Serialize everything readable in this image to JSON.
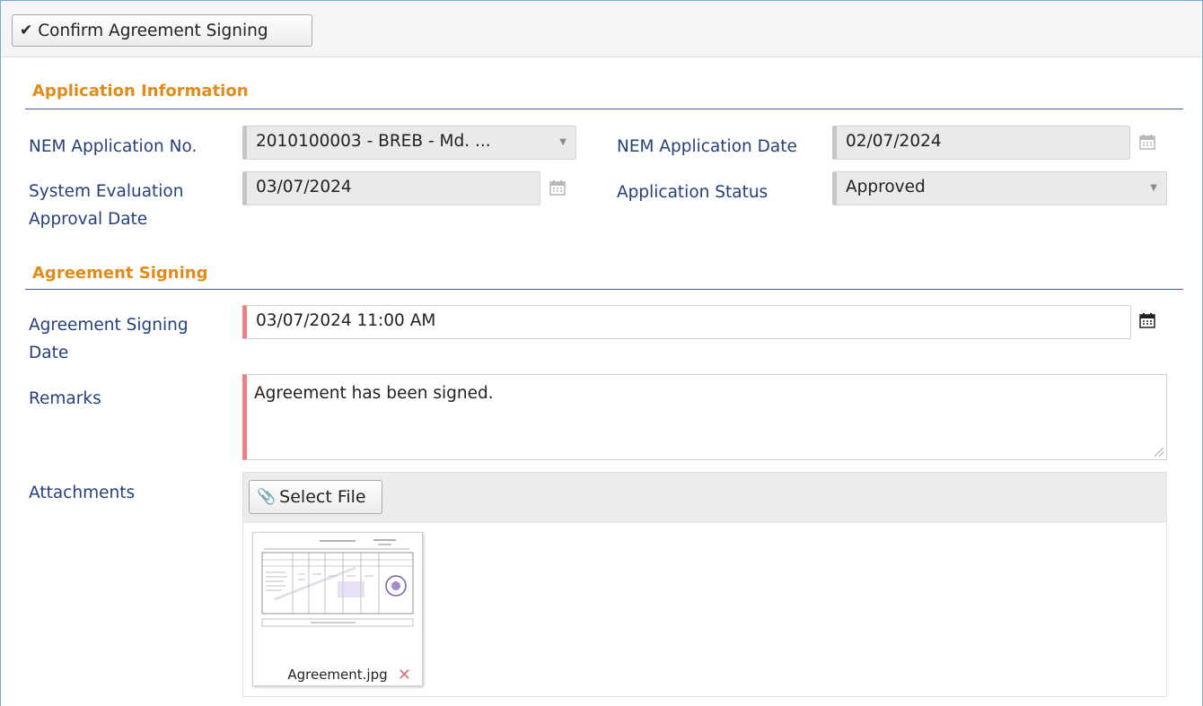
{
  "toolbar": {
    "confirm_label": "Confirm Agreement Signing",
    "confirm_icon": "check-icon"
  },
  "application_info": {
    "title": "Application Information",
    "nem_app_no_label": "NEM Application No.",
    "nem_app_no_value": "2010100003 - BREB - Md. ...",
    "nem_app_date_label": "NEM Application Date",
    "nem_app_date_value": "02/07/2024",
    "sys_eval_label_1": "System Evaluation",
    "sys_eval_label_2": "Approval Date",
    "sys_eval_value": "03/07/2024",
    "app_status_label": "Application Status",
    "app_status_value": "Approved"
  },
  "agreement_signing": {
    "title": "Agreement Signing",
    "signing_date_label_1": "Agreement Signing",
    "signing_date_label_2": "Date",
    "signing_date_value": "03/07/2024 11:00 AM",
    "remarks_label": "Remarks",
    "remarks_value": "Agreement has been signed.",
    "attachments_label": "Attachments",
    "select_file_label": "Select File",
    "files": [
      {
        "name": "Agreement.jpg"
      }
    ]
  },
  "colors": {
    "section_title": "#e08b1a",
    "label": "#26407e",
    "required_marker": "#f08080",
    "remove_icon": "#e07070"
  }
}
